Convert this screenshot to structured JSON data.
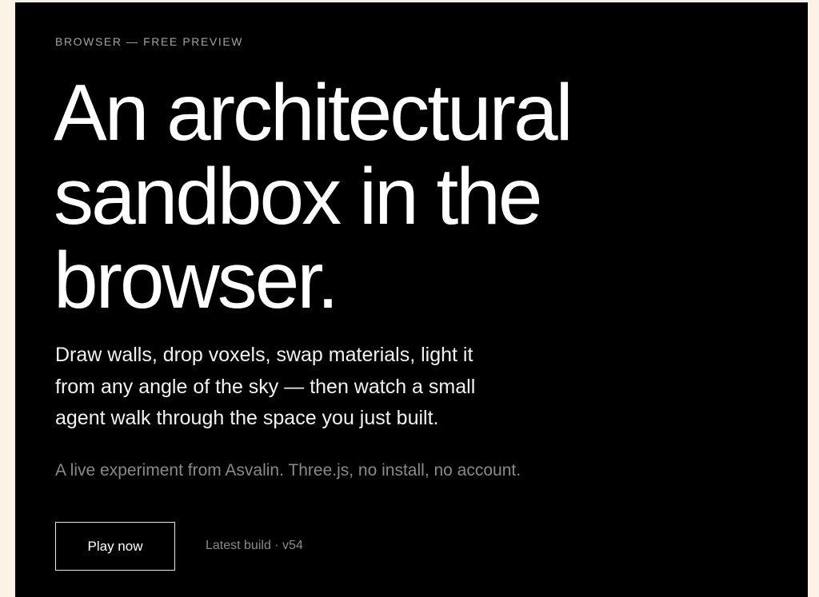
{
  "hero": {
    "eyebrow": "BROWSER — FREE PREVIEW",
    "headline_lines": [
      "An architectural",
      "sandbox in the",
      "browser."
    ],
    "lede_lines": [
      "Draw walls, drop voxels, swap materials, light it",
      "from any angle of the sky — then watch a small",
      "agent walk through the space you just built."
    ],
    "meta": "A live experiment from Asvalin. Three.js, no install, no account.",
    "play_label": "Play now",
    "build_label": "Latest build · v54"
  },
  "colors": {
    "page_bg": "#fcf2e6",
    "panel_bg": "#000000",
    "text_primary": "#ffffff",
    "text_muted": "#8a8a8a"
  }
}
